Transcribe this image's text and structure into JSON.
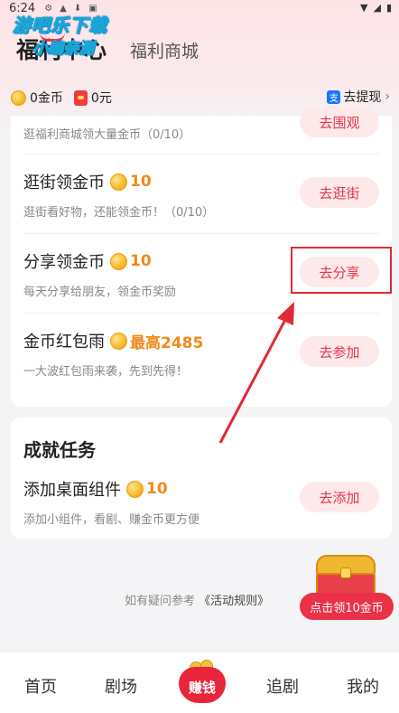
{
  "status_bar": {
    "time": "6:24"
  },
  "watermark": {
    "line1": "游吧乐下载",
    "line2": "小编亲测"
  },
  "header": {
    "active_tab": "福利中心",
    "inactive_tab": "福利商城"
  },
  "balance": {
    "coins": "0金币",
    "cash": "0元",
    "withdraw": "去提现"
  },
  "tasks": [
    {
      "title": "",
      "reward": "",
      "desc": "逛福利商城领大量金币（0/10）",
      "button": "去围观"
    },
    {
      "title": "逛街领金币",
      "reward": "10",
      "desc": "逛街看好物，还能领金币！（0/10）",
      "button": "去逛街"
    },
    {
      "title": "分享领金币",
      "reward": "10",
      "desc": "每天分享给朋友，领金币奖励",
      "button": "去分享"
    },
    {
      "title": "金币红包雨",
      "reward": "最高2485",
      "desc": "一大波红包雨来袭，先到先得！",
      "button": "去参加"
    }
  ],
  "achievement": {
    "section_title": "成就任务",
    "task": {
      "title": "添加桌面组件",
      "reward": "10",
      "desc": "添加小组件，看剧、赚金币更方便",
      "button": "去添加"
    }
  },
  "rules": {
    "prefix": "如有疑问参考",
    "link": "《活动规则》"
  },
  "chest_button": "点击领10金币",
  "bottom_nav": {
    "home": "首页",
    "theater": "剧场",
    "earn": "赚钱",
    "follow": "追剧",
    "mine": "我的"
  },
  "colors": {
    "accent": "#e8334a",
    "reward": "#f08a1a",
    "annotation": "#e02a35"
  }
}
